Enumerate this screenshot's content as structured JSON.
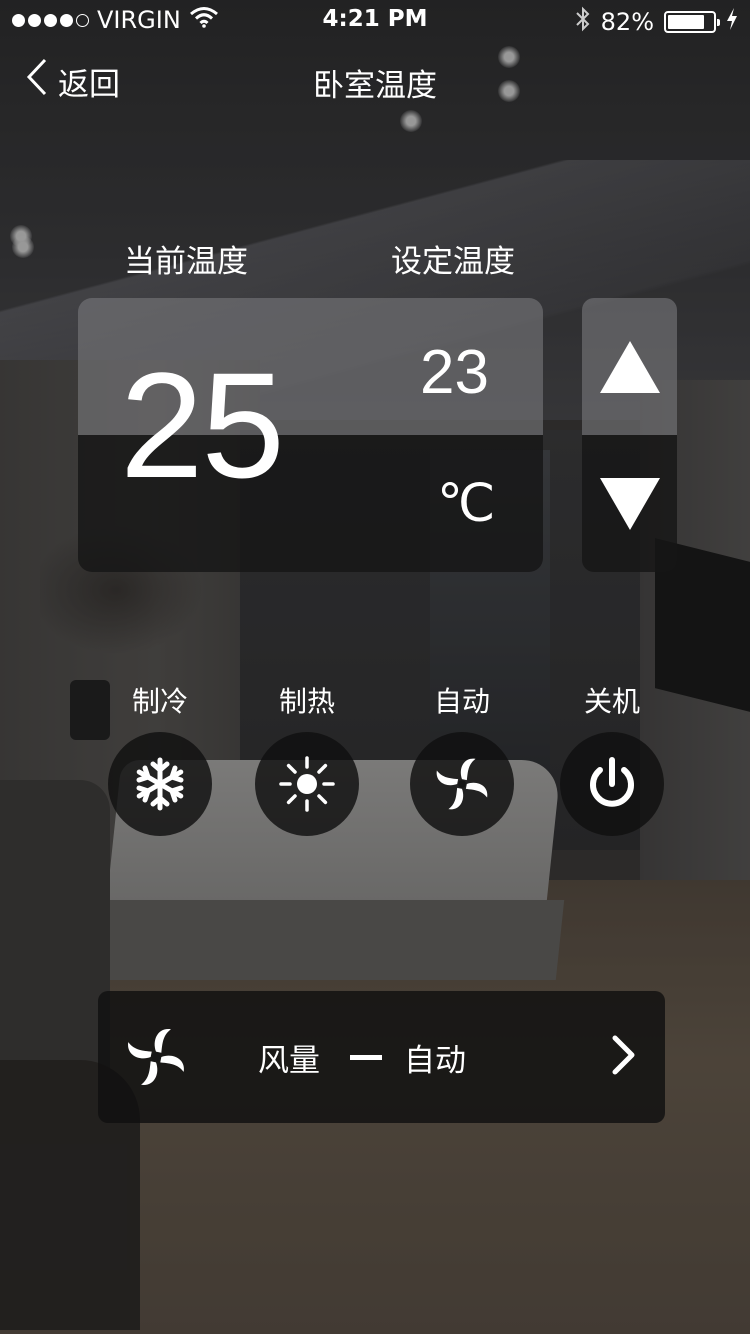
{
  "status_bar": {
    "carrier": "VIRGIN",
    "signal_dots_filled": 4,
    "signal_dots_total": 5,
    "time": "4:21 PM",
    "battery_percent": "82%",
    "battery_level": 0.82,
    "icons": [
      "wifi-icon",
      "bluetooth-icon",
      "battery-icon",
      "charging-icon"
    ]
  },
  "nav": {
    "back_label": "返回",
    "title": "卧室温度"
  },
  "temperature": {
    "current_label": "当前温度",
    "set_label": "设定温度",
    "current_value": "25",
    "set_value": "23",
    "unit": "℃"
  },
  "modes": [
    {
      "label": "制冷",
      "icon": "snowflake-icon"
    },
    {
      "label": "制热",
      "icon": "sun-icon"
    },
    {
      "label": "自动",
      "icon": "fan-icon"
    },
    {
      "label": "关机",
      "icon": "power-icon"
    }
  ],
  "fan_speed": {
    "label": "风量",
    "value": "自动",
    "icon": "fan-icon"
  },
  "colors": {
    "text": "#ffffff",
    "panel_light": "#7a7a7c",
    "panel_dark": "#161616"
  }
}
